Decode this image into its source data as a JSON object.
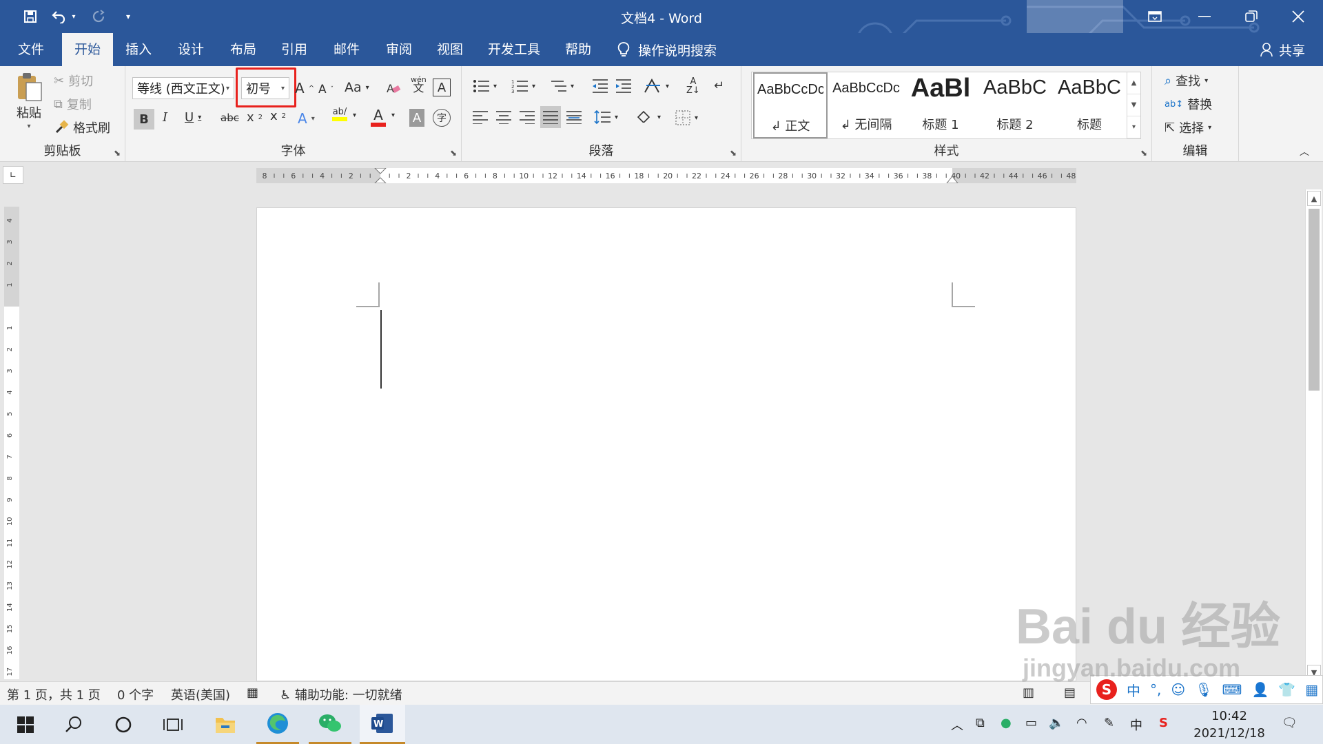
{
  "window": {
    "title": "文档4  -  Word",
    "controls": [
      "ribbon-display-icon",
      "minimize-icon",
      "restore-icon",
      "close-icon"
    ]
  },
  "tabs": [
    {
      "label": "文件",
      "active": false
    },
    {
      "label": "开始",
      "active": true
    },
    {
      "label": "插入",
      "active": false
    },
    {
      "label": "设计",
      "active": false
    },
    {
      "label": "布局",
      "active": false
    },
    {
      "label": "引用",
      "active": false
    },
    {
      "label": "邮件",
      "active": false
    },
    {
      "label": "审阅",
      "active": false
    },
    {
      "label": "视图",
      "active": false
    },
    {
      "label": "开发工具",
      "active": false
    },
    {
      "label": "帮助",
      "active": false
    }
  ],
  "tell_me": "操作说明搜索",
  "share": "共享",
  "clipboard": {
    "paste": "粘贴",
    "cut": "剪切",
    "copy": "复制",
    "format_painter": "格式刷",
    "label": "剪贴板"
  },
  "font": {
    "font_name": "等线 (西文正文)",
    "font_size": "初号",
    "label": "字体",
    "highlighted_control": "font-size",
    "highlight_color": "#e8211d",
    "text_highlight_color": "#ffff00",
    "font_color": "#e8211d"
  },
  "paragraph": {
    "label": "段落"
  },
  "styles": {
    "label": "样式",
    "items": [
      {
        "sample": "AaBbCcDc",
        "name": "↲ 正文",
        "selected": true
      },
      {
        "sample": "AaBbCcDc",
        "name": "↲ 无间隔",
        "selected": false
      },
      {
        "sample": "AaBl",
        "name": "标题 1",
        "selected": false
      },
      {
        "sample": "AaBbC",
        "name": "标题 2",
        "selected": false
      },
      {
        "sample": "AaBbC",
        "name": "标题",
        "selected": false
      }
    ]
  },
  "editing": {
    "find": "查找",
    "replace": "替换",
    "select": "选择",
    "label": "编辑"
  },
  "ruler": {
    "ticks": [
      "8",
      "6",
      "4",
      "2",
      "",
      "2",
      "4",
      "6",
      "8",
      "10",
      "12",
      "14",
      "16",
      "18",
      "20",
      "22",
      "24",
      "26",
      "28",
      "30",
      "32",
      "34",
      "36",
      "38",
      "40",
      "42",
      "44",
      "46",
      "48"
    ],
    "vticks": [
      "4",
      "3",
      "2",
      "1",
      "",
      "1",
      "2",
      "3",
      "4",
      "5",
      "6",
      "7",
      "8",
      "9",
      "10",
      "11",
      "12",
      "13",
      "14",
      "15",
      "16",
      "17"
    ]
  },
  "status": {
    "page": "第 1 页，共 1 页",
    "words": "0 个字",
    "language": "英语(美国)",
    "accessibility": "辅助功能: 一切就绪"
  },
  "ime": {
    "mode": "中"
  },
  "taskbar": {
    "time": "10:42",
    "date": "2021/12/18",
    "tray_lang": "中"
  },
  "watermark": {
    "line1": "Bai du 经验",
    "line2": "jingyan.baidu.com"
  }
}
